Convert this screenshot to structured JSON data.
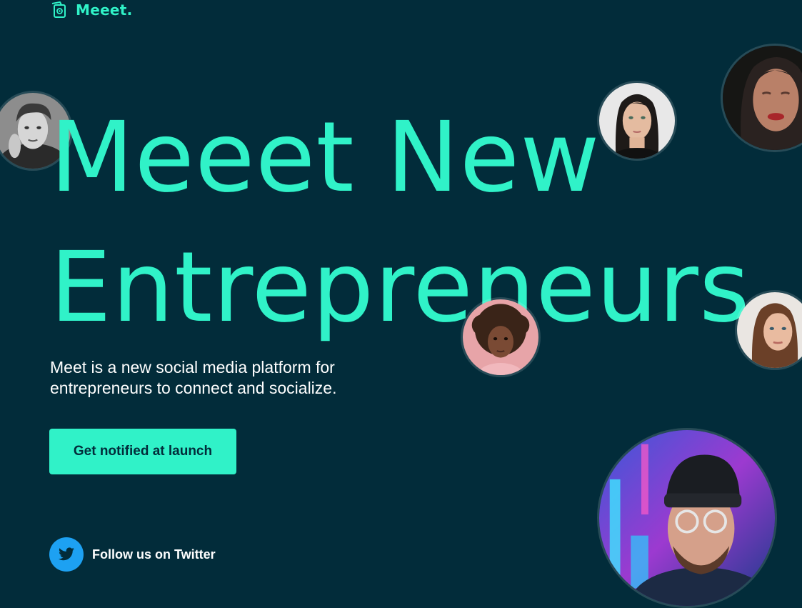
{
  "brand": {
    "name": "Meeet.",
    "icon": "meeet-logo-icon",
    "accent_color": "#30f2c8",
    "background_color": "#022c3a"
  },
  "hero": {
    "title_line1": "Meeet New",
    "title_line2": "Entrepreneurs",
    "subtitle": "Meet is a new social media platform for entrepreneurs to connect and socialize."
  },
  "cta": {
    "label": "Get notified at launch"
  },
  "social": {
    "twitter_label": "Follow us on Twitter",
    "twitter_icon": "twitter-icon",
    "twitter_color": "#1da1f2"
  },
  "avatars": [
    {
      "name": "avatar-man-black-white"
    },
    {
      "name": "avatar-woman-dark-hair"
    },
    {
      "name": "avatar-woman-red-lips"
    },
    {
      "name": "avatar-girl-curly-hair"
    },
    {
      "name": "avatar-woman-brown-hair"
    },
    {
      "name": "avatar-man-beanie-neon"
    }
  ]
}
